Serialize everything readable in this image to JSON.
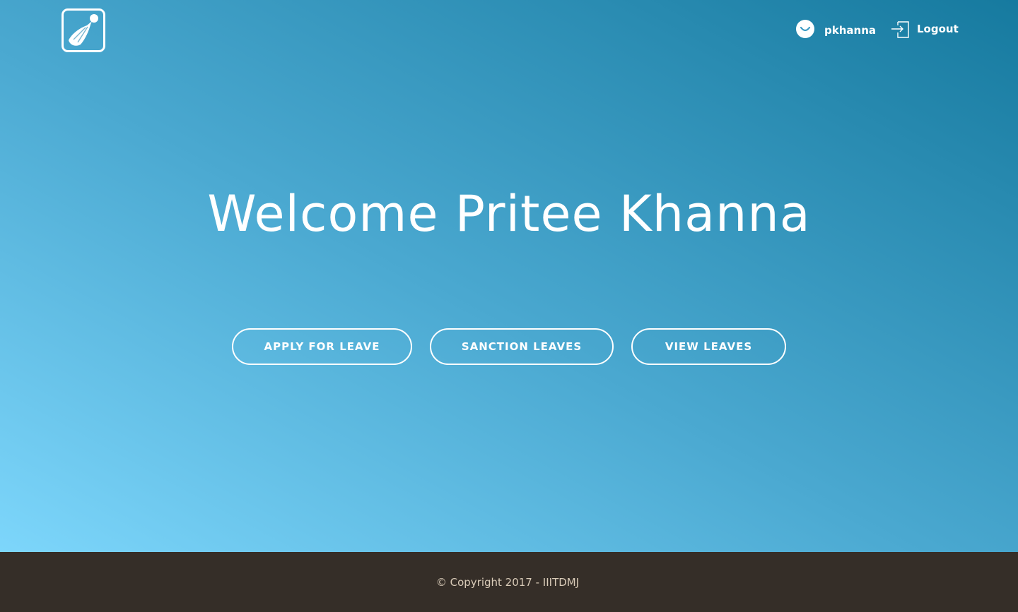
{
  "header": {
    "username": "pkhanna",
    "logout_label": "Logout"
  },
  "main": {
    "welcome_text": "Welcome Pritee Khanna",
    "buttons": {
      "apply": "APPLY FOR LEAVE",
      "sanction": "SANCTION LEAVES",
      "view": "VIEW  LEAVES"
    }
  },
  "footer": {
    "copyright": "© Copyright 2017 - IIITDMJ"
  },
  "icons": {
    "logo": "shuttlecock-logo-icon",
    "avatar": "smiley-avatar-icon",
    "logout": "login-arrow-icon"
  },
  "colors": {
    "gradient_light": "#7dd6fb",
    "gradient_dark": "#167a9f",
    "footer_bg": "#352e28",
    "footer_text": "#d9cbb8"
  }
}
